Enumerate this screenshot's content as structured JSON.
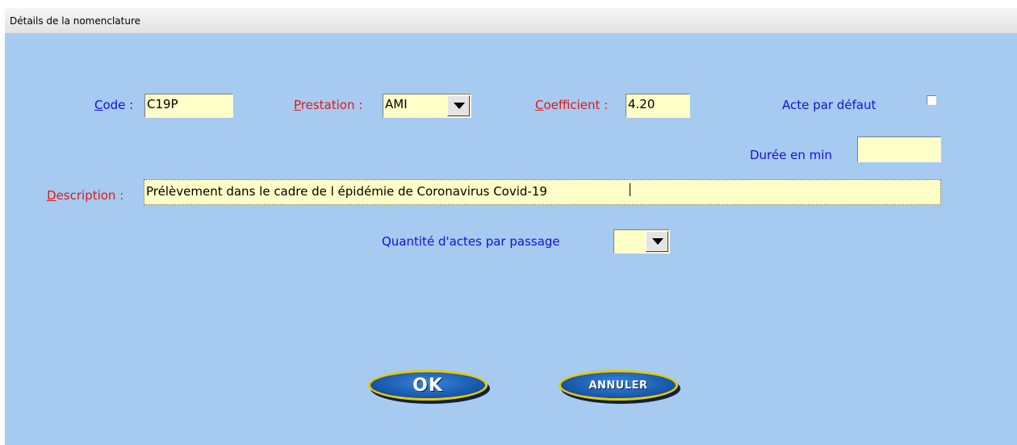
{
  "window": {
    "title": "Détails de la nomenclature"
  },
  "form": {
    "code": {
      "label_key": "C",
      "label_rest": "ode :",
      "value": "C19P"
    },
    "prestation": {
      "label_key": "P",
      "label_rest": "restation :",
      "value": "AMI"
    },
    "coefficient": {
      "label_key": "C",
      "label_rest": "oefficient :",
      "value": "4.20"
    },
    "acte_defaut": {
      "label": "Acte par défaut",
      "checked": false
    },
    "duree": {
      "label": "Durée en min",
      "value": ""
    },
    "description": {
      "label_key": "D",
      "label_rest": "escription :",
      "value": "Prélèvement dans le cadre de l épidémie de Coronavirus Covid-19"
    },
    "quantite": {
      "label": "Quantité d'actes par passage",
      "value": ""
    }
  },
  "buttons": {
    "ok": "OK",
    "cancel": "ANNULER"
  },
  "colors": {
    "background": "#a6caf0",
    "field_bg": "#ffffc8",
    "label_blue": "#1010e8",
    "label_red": "#e01818",
    "button_blue": "#1b5fb4",
    "button_border": "#e8c800"
  }
}
